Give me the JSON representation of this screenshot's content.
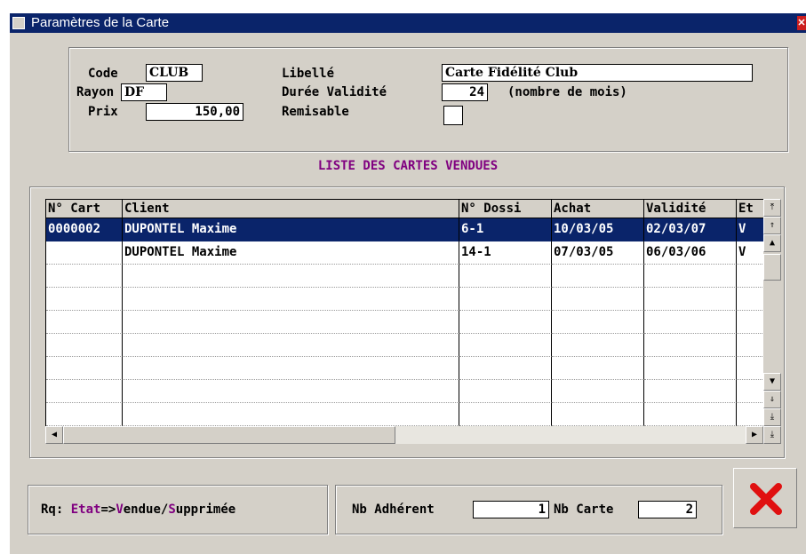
{
  "window": {
    "title": "Paramètres de la Carte",
    "close_glyph": "✕"
  },
  "form": {
    "code_label": "Code",
    "code_value": "CLUB",
    "rayon_label": "Rayon",
    "rayon_value": "DF",
    "prix_label": "Prix",
    "prix_value": "150,00",
    "libelle_label": "Libellé",
    "libelle_value": "Carte Fidélité Club",
    "duree_label": "Durée Validité",
    "duree_value": "24",
    "duree_unit": "(nombre de mois)",
    "remisable_label": "Remisable",
    "remisable_checked": false
  },
  "list": {
    "title": "LISTE DES CARTES VENDUES",
    "columns": [
      "N° Cart",
      "Client",
      "N° Dossi",
      "Achat",
      "Validité",
      "Et"
    ],
    "rows": [
      {
        "carte": "0000002",
        "client": "DUPONTEL Maxime",
        "dossier": "6-1",
        "achat": "10/03/05",
        "validite": "02/03/07",
        "etat": "V",
        "selected": true
      },
      {
        "carte": "",
        "client": "DUPONTEL Maxime",
        "dossier": "14-1",
        "achat": "07/03/05",
        "validite": "06/03/06",
        "etat": "V",
        "selected": false
      }
    ],
    "empty_rows": 7
  },
  "footer": {
    "rq_label": "Rq:",
    "rq_etat": "Etat",
    "rq_arrow": "=>",
    "rq_v": "V",
    "rq_vendue_rest": "endue/",
    "rq_s": "S",
    "rq_supprimee_rest": "upprimée",
    "nb_adherent_label": "Nb Adhérent",
    "nb_adherent_value": "1",
    "nb_carte_label": "Nb Carte",
    "nb_carte_value": "2"
  },
  "colors": {
    "title_bar": "#0a246a",
    "accent_purple": "#800080",
    "cancel_red": "#e01010"
  },
  "icons": {
    "cancel": "cancel-x-icon",
    "scroll_up": "arrow-up-icon",
    "scroll_down": "arrow-down-icon"
  }
}
